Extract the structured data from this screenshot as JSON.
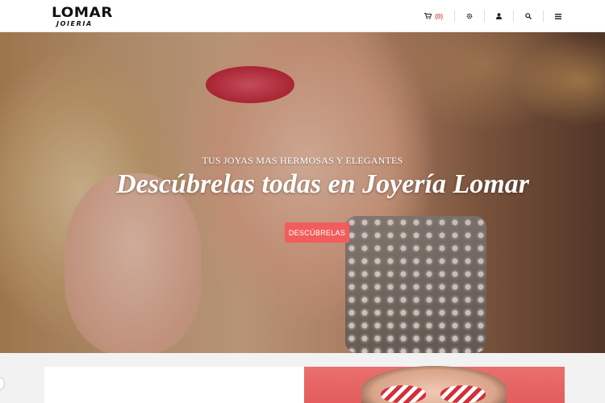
{
  "brand": {
    "name": "LOMAR",
    "subtitle": "JOIERIA"
  },
  "nav": {
    "cart_icon": "cart-icon",
    "cart_count": "(0)",
    "items": [
      "settings-icon",
      "user-icon",
      "search-icon",
      "menu-icon"
    ]
  },
  "hero": {
    "subtitle": "TUS JOYAS MAS HERMOSAS Y ELEGANTES",
    "title": "Descúbrelas todas en Joyería  Lomar",
    "button_label": "DESCÚBRELAS"
  },
  "colors": {
    "accent": "#f25c5c",
    "header_bg": "#ffffff",
    "promo_bg": "#e35d5d"
  }
}
